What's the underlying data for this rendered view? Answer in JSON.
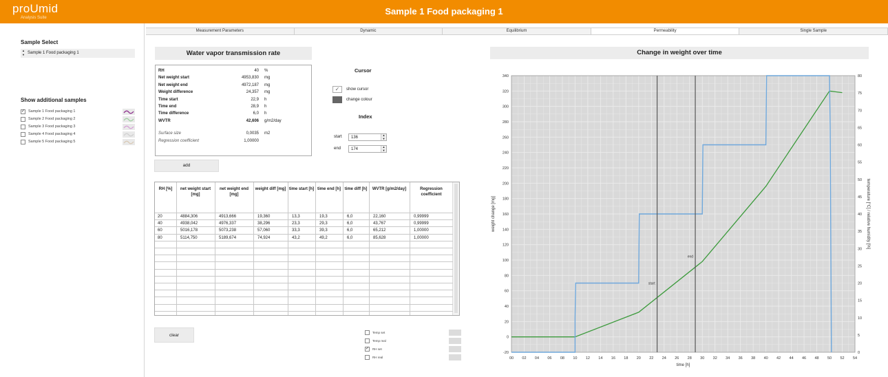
{
  "app": {
    "brand": "proUmid",
    "brand_sub": "Analysis Suite",
    "window_title": "Sample 1 Food packaging 1"
  },
  "tabs": [
    {
      "label": "Measurement Parameters",
      "active": false
    },
    {
      "label": "Dynamic",
      "active": false
    },
    {
      "label": "Equilibrium",
      "active": false
    },
    {
      "label": "Permeability",
      "active": true
    },
    {
      "label": "Single Sample",
      "active": false
    }
  ],
  "sidebar": {
    "sample_select_title": "Sample Select",
    "sample_select_value": "Sample 1 Food packaging 1",
    "additional_title": "Show additional samples",
    "additional_samples": [
      {
        "label": "Sample 1 Food packaging 1",
        "checked": true,
        "swatch_color": "#8b2a8b"
      },
      {
        "label": "Sample 2 Food packaging 2",
        "checked": false,
        "swatch_color": "#9ecfa0"
      },
      {
        "label": "Sample 3 Food packaging 3",
        "checked": false,
        "swatch_color": "#d6a0d6"
      },
      {
        "label": "Sample 4 Food packaging 4",
        "checked": false,
        "swatch_color": "#cfcfcf"
      },
      {
        "label": "Sample 5 Food packaging 5",
        "checked": false,
        "swatch_color": "#d9c9b5"
      }
    ]
  },
  "wvtr": {
    "title": "Water vapor transmission rate",
    "rows": [
      {
        "key": "RH",
        "value": "40",
        "unit": "%"
      },
      {
        "key": "Net weight start",
        "value": "4953,830",
        "unit": "mg"
      },
      {
        "key": "Net weight end",
        "value": "4972,187",
        "unit": "mg"
      },
      {
        "key": "Weight difference",
        "value": "24,357",
        "unit": "mg"
      },
      {
        "key": "Time start",
        "value": "22,9",
        "unit": "h"
      },
      {
        "key": "Time end",
        "value": "28,9",
        "unit": "h"
      },
      {
        "key": "Time difference",
        "value": "6,0",
        "unit": "h"
      },
      {
        "key": "WVTR",
        "value": "42,606",
        "unit": "g/m2/day"
      }
    ],
    "extra_rows": [
      {
        "key": "Surface size",
        "value": "0,0035",
        "unit": "m2"
      },
      {
        "key": "Regression coefficient",
        "value": "1,00000",
        "unit": ""
      }
    ],
    "add_label": "add"
  },
  "cursor": {
    "title": "Cursor",
    "show_cursor_label": "show cursor",
    "show_cursor_checked": true,
    "change_colour_label": "change colour",
    "cursor_color": "#666666"
  },
  "index": {
    "title": "Index",
    "start_label": "start",
    "start_value": "136",
    "end_label": "end",
    "end_value": "174"
  },
  "results": {
    "headers": [
      "RH [%]",
      "net weight start [mg]",
      "net weight end [mg]",
      "weight diff [mg]",
      "time start [h]",
      "time end [h]",
      "time diff [h]",
      "WVTR [g/m2/day]",
      "Regression coefficient"
    ],
    "rows": [
      [
        "20",
        "4884,306",
        "4913,666",
        "19,360",
        "13,3",
        "19,3",
        "6,0",
        "22,160",
        "0,99999"
      ],
      [
        "40",
        "4938,042",
        "4976,337",
        "38,296",
        "23,3",
        "29,3",
        "6,0",
        "43,767",
        "0,99999"
      ],
      [
        "60",
        "5016,178",
        "5073,238",
        "57,060",
        "33,3",
        "39,3",
        "6,0",
        "65,212",
        "1,00000"
      ],
      [
        "80",
        "5114,750",
        "5189,674",
        "74,924",
        "43,2",
        "49,2",
        "6,0",
        "85,628",
        "1,00000"
      ]
    ],
    "clear_label": "clear"
  },
  "toggles": [
    {
      "label": "Temp set",
      "checked": false
    },
    {
      "label": "Temp real",
      "checked": false
    },
    {
      "label": "RH set",
      "checked": true
    },
    {
      "label": "RH real",
      "checked": false
    }
  ],
  "chart": {
    "title": "Change in weight over time"
  },
  "chart_data": {
    "type": "line",
    "xlabel": "time [h]",
    "ylabel": "weight change [mg]",
    "y2label": "temperature [°C] / relative humidity [%]",
    "xlim": [
      0,
      54
    ],
    "ylim": [
      -20,
      340
    ],
    "y2lim": [
      0,
      80
    ],
    "x_ticks": [
      "00",
      "02",
      "04",
      "06",
      "08",
      "10",
      "12",
      "14",
      "16",
      "18",
      "20",
      "22",
      "24",
      "26",
      "28",
      "30",
      "32",
      "34",
      "36",
      "38",
      "40",
      "42",
      "44",
      "46",
      "48",
      "50",
      "52",
      "54"
    ],
    "y_ticks": [
      -20,
      0,
      20,
      40,
      60,
      80,
      100,
      120,
      140,
      160,
      180,
      200,
      220,
      240,
      260,
      280,
      300,
      320,
      340
    ],
    "y2_ticks": [
      0,
      5,
      10,
      15,
      20,
      25,
      30,
      35,
      40,
      45,
      50,
      55,
      60,
      65,
      70,
      75,
      80
    ],
    "grid": true,
    "series": [
      {
        "axis": "left",
        "color": "#3b9a3b",
        "points": [
          [
            0,
            0
          ],
          [
            10,
            0
          ],
          [
            20,
            32
          ],
          [
            30,
            98
          ],
          [
            40,
            196
          ],
          [
            50,
            320
          ],
          [
            52,
            318
          ]
        ]
      },
      {
        "axis": "right",
        "color": "#6fa8dc",
        "points": [
          [
            0,
            0
          ],
          [
            10,
            0
          ],
          [
            10,
            10
          ],
          [
            10.1,
            20
          ],
          [
            20,
            20
          ],
          [
            20.1,
            40
          ],
          [
            30,
            40
          ],
          [
            30.1,
            60
          ],
          [
            40,
            60
          ],
          [
            40.1,
            80
          ],
          [
            50,
            80
          ],
          [
            50.1,
            65
          ],
          [
            50.3,
            0
          ]
        ]
      }
    ],
    "cursors": [
      {
        "x": 22.9,
        "label": "start"
      },
      {
        "x": 28.9,
        "label": "end"
      }
    ]
  }
}
